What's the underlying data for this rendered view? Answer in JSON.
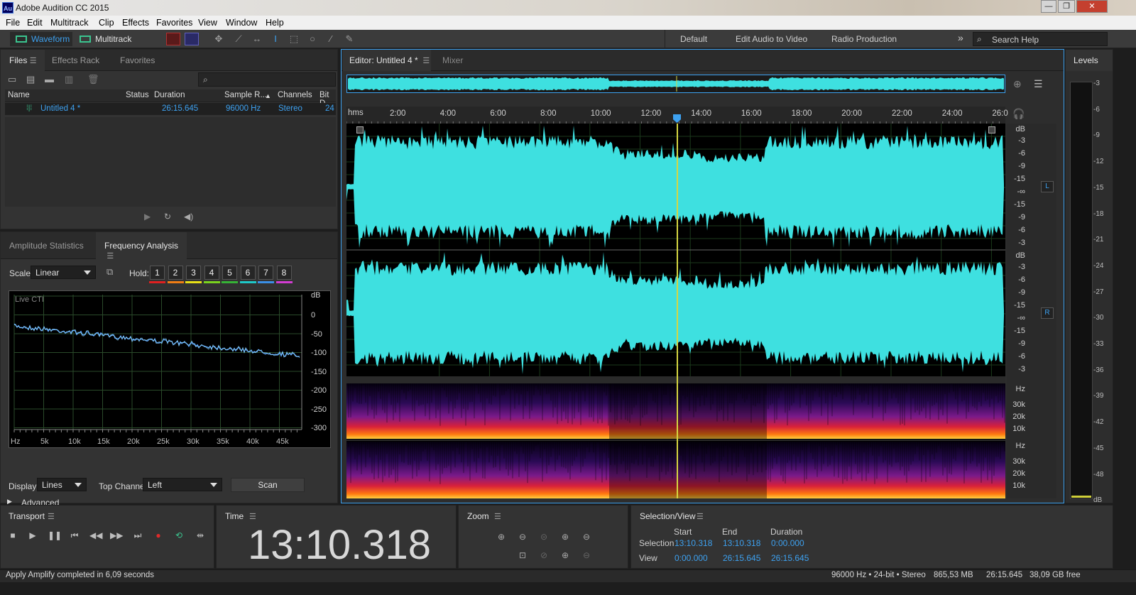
{
  "app": {
    "icon_text": "Au",
    "title": "Adobe Audition CC 2015"
  },
  "window_controls": {
    "minimize": "—",
    "maximize": "❐",
    "close": "✕"
  },
  "menu": [
    "File",
    "Edit",
    "Multitrack",
    "Clip",
    "Effects",
    "Favorites",
    "View",
    "Window",
    "Help"
  ],
  "toolbar": {
    "waveform_label": "Waveform",
    "multitrack_label": "Multitrack",
    "workspaces": [
      "Default",
      "Edit Audio to Video",
      "Radio Production"
    ],
    "more": "»",
    "search_placeholder": "Search Help"
  },
  "files_panel": {
    "tabs": [
      "Files",
      "Effects Rack",
      "Favorites"
    ],
    "search_icon": "⌕",
    "columns": [
      "Name",
      "Status",
      "Duration",
      "Sample R...",
      "Channels",
      "Bit D"
    ],
    "rows": [
      {
        "name": "Untitled 4 *",
        "status": "",
        "duration": "26:15.645",
        "sample_rate": "96000 Hz",
        "channels": "Stereo",
        "bit_depth": "24"
      }
    ]
  },
  "analysis_panel": {
    "tabs": [
      "Amplitude Statistics",
      "Frequency Analysis"
    ],
    "scale_label": "Scale:",
    "scale_value": "Linear",
    "hold_label": "Hold:",
    "hold_buttons": [
      "1",
      "2",
      "3",
      "4",
      "5",
      "6",
      "7",
      "8"
    ],
    "hold_colors": [
      "#e02020",
      "#f07d14",
      "#e8e016",
      "#7ad31e",
      "#36b336",
      "#1ec8c8",
      "#3a8fe6",
      "#d23cd2"
    ],
    "graph_label": "Live CTI",
    "db_unit": "dB",
    "db_ticks": [
      "0",
      "-50",
      "-100",
      "-150",
      "-200",
      "-250",
      "-300"
    ],
    "hz_ticks": [
      "Hz",
      "5k",
      "10k",
      "15k",
      "20k",
      "25k",
      "30k",
      "35k",
      "40k",
      "45k"
    ],
    "display_label": "Display:",
    "display_value": "Lines",
    "top_channel_label": "Top Channel:",
    "top_channel_value": "Left",
    "scan_label": "Scan",
    "advanced_label": "Advanced"
  },
  "editor": {
    "tabs": [
      "Editor: Untitled 4 *",
      "Mixer"
    ],
    "ruler_unit": "hms",
    "ruler_ticks": [
      "2:00",
      "4:00",
      "6:00",
      "8:00",
      "10:00",
      "12:00",
      "14:00",
      "16:00",
      "18:00",
      "20:00",
      "22:00",
      "24:00",
      "26:0"
    ],
    "db_scale_unit": "dB",
    "db_scale": [
      "-3",
      "-6",
      "-9",
      "-15",
      "-∞",
      "-15",
      "-9",
      "-6",
      "-3"
    ],
    "channel_left": "L",
    "channel_right": "R",
    "hz_unit": "Hz",
    "hz_scale": [
      "30k",
      "20k",
      "10k"
    ]
  },
  "levels": {
    "title": "Levels",
    "ticks": [
      "-3",
      "-6",
      "-9",
      "-12",
      "-15",
      "-18",
      "-21",
      "-24",
      "-27",
      "-30",
      "-33",
      "-36",
      "-39",
      "-42",
      "-45",
      "-48",
      "dB"
    ]
  },
  "transport": {
    "title": "Transport"
  },
  "time": {
    "title": "Time",
    "value": "13:10.318"
  },
  "zoom": {
    "title": "Zoom"
  },
  "selection_view": {
    "title": "Selection/View",
    "headers": [
      "Start",
      "End",
      "Duration"
    ],
    "selection_label": "Selection",
    "selection": [
      "13:10.318",
      "13:10.318",
      "0:00.000"
    ],
    "view_label": "View",
    "view": [
      "0:00.000",
      "26:15.645",
      "26:15.645"
    ]
  },
  "status": {
    "message": "Apply Amplify completed in 6,09 seconds",
    "format": "96000 Hz • 24-bit • Stereo",
    "size": "865,53 MB",
    "duration": "26:15.645",
    "free": "38,09 GB free"
  },
  "colors": {
    "accent": "#3da1f0",
    "waveform": "#3ee0e0",
    "playhead": "#d6d641"
  }
}
